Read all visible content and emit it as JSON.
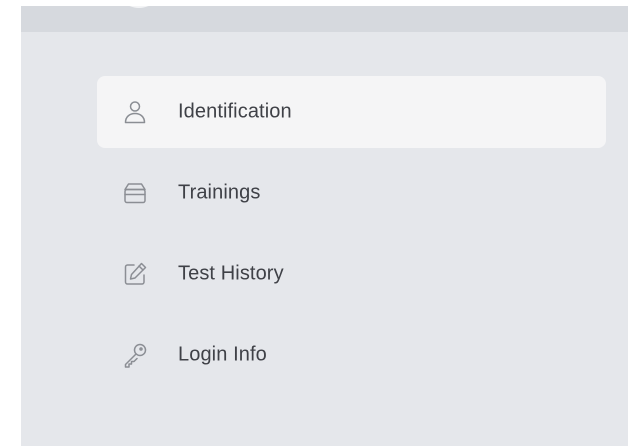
{
  "nav": {
    "items": [
      {
        "label": "Identification",
        "icon": "user-icon",
        "active": true
      },
      {
        "label": "Trainings",
        "icon": "archive-box-icon",
        "active": false
      },
      {
        "label": "Test History",
        "icon": "edit-icon",
        "active": false
      },
      {
        "label": "Login Info",
        "icon": "key-icon",
        "active": false
      }
    ]
  },
  "colors": {
    "panel_bg": "#e5e7eb",
    "active_item_bg": "#f5f5f6",
    "label_text": "#3f4147",
    "icon_stroke": "#8b8e94"
  }
}
